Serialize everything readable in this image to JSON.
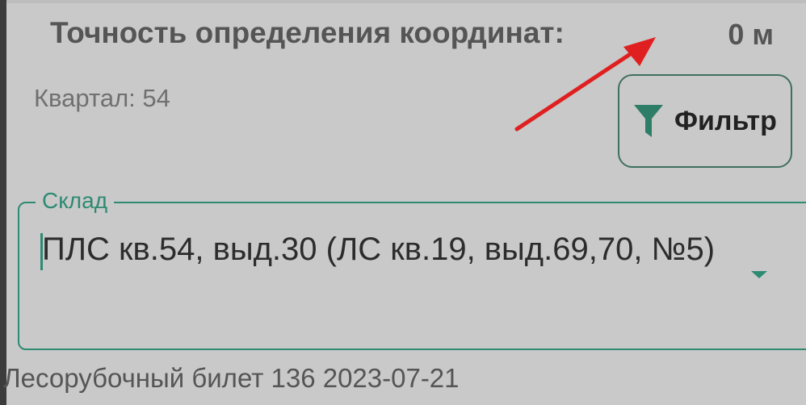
{
  "header": {
    "accuracy_label": "Точность определения координат:",
    "accuracy_value": "0 м"
  },
  "quarter_text": "Квартал: 54",
  "filter": {
    "label": "Фильтр",
    "icon": "filter-icon"
  },
  "warehouse": {
    "legend": "Склад",
    "value": "ПЛС кв.54, выд.30 (ЛС кв.19, выд.69,70, №5)",
    "dropdown_icon": "chevron-down-icon"
  },
  "ticket_text": "Лесорубочный билет 136 2023-07-21",
  "colors": {
    "accent": "#2e8a72",
    "filter_border": "#3f6f62",
    "background": "#c9c9c9",
    "annotation_arrow": "#e02020"
  }
}
